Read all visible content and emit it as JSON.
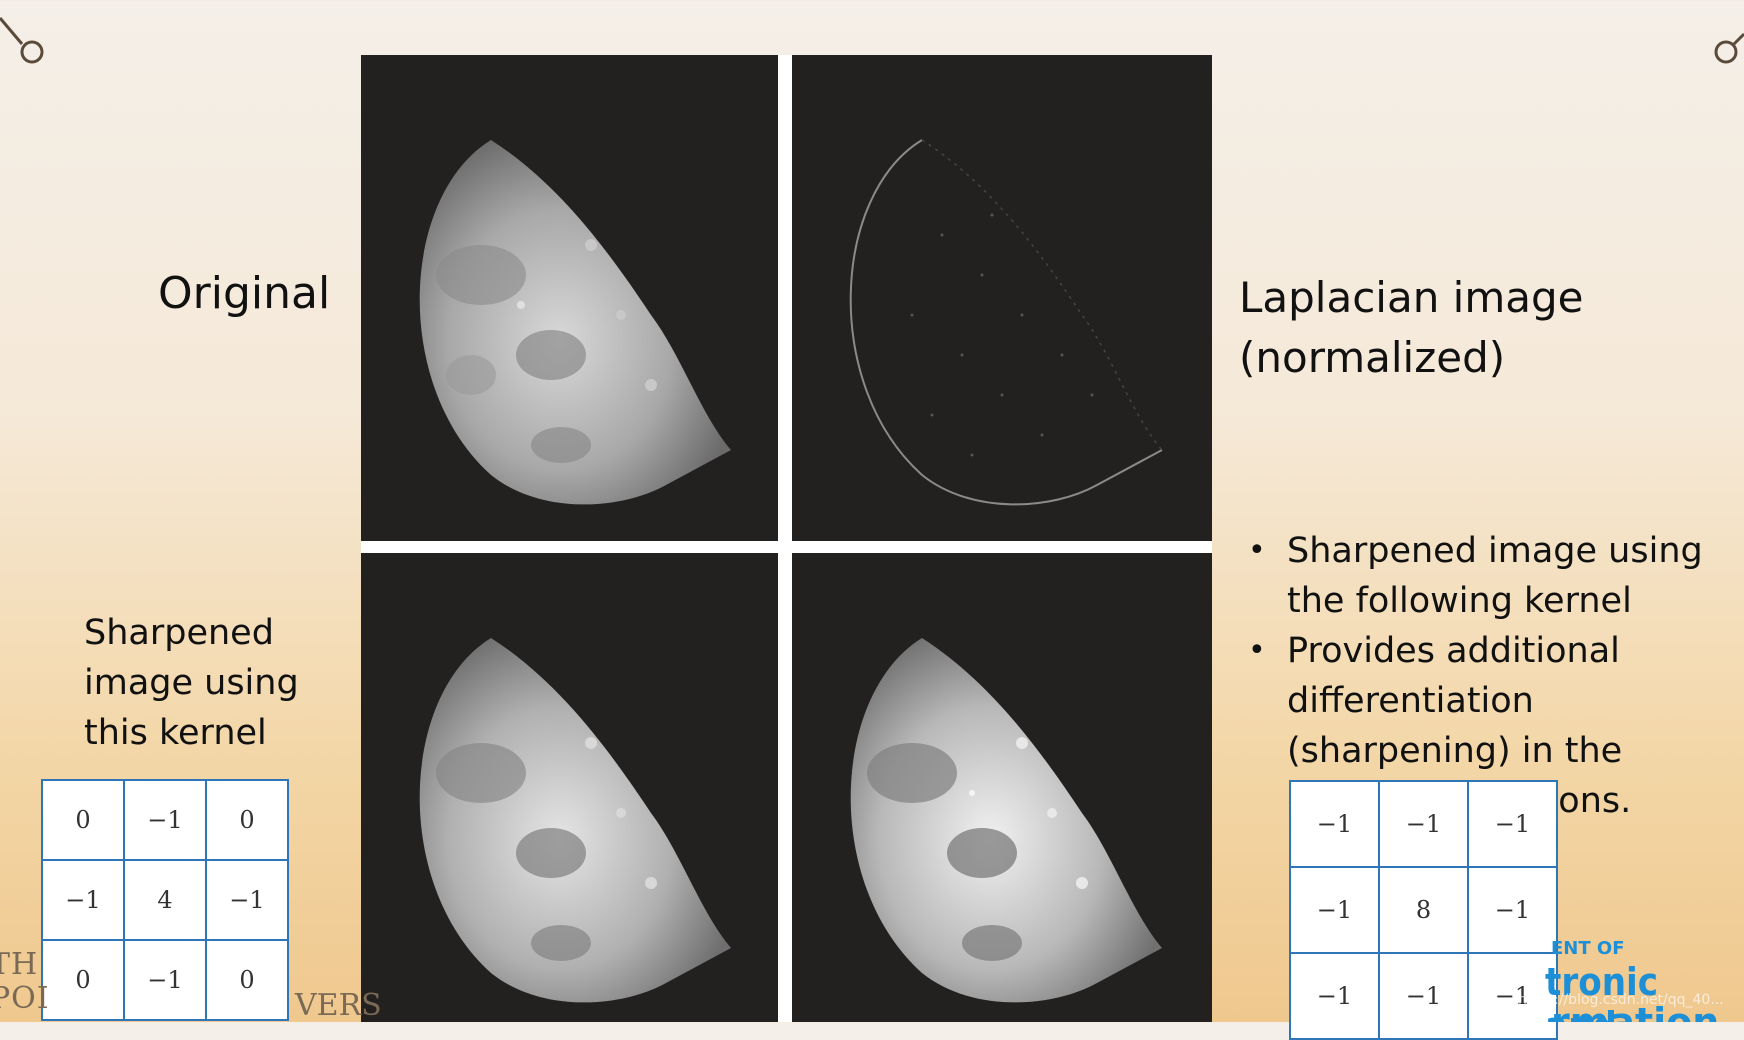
{
  "labels": {
    "original": "Original",
    "laplacian_line1": "Laplacian image",
    "laplacian_line2": "(normalized)",
    "sharpened_line1": "Sharpened",
    "sharpened_line2": "image using",
    "sharpened_line3": "this kernel"
  },
  "bullets": [
    "Sharpened image using the following kernel",
    "Provides additional differentiation (sharpening) in the diagonal directions."
  ],
  "kernels": {
    "left": [
      [
        "0",
        "−1",
        "0"
      ],
      [
        "−1",
        "4",
        "−1"
      ],
      [
        "0",
        "−1",
        "0"
      ]
    ],
    "right": [
      [
        "−1",
        "−1",
        "−1"
      ],
      [
        "−1",
        "8",
        "−1"
      ],
      [
        "−1",
        "−1",
        "−1"
      ]
    ]
  },
  "footer": {
    "line1": "TH",
    "line2": "POI",
    "line3": "VERS",
    "logo_line1": "ENT OF",
    "logo_line2": "tronic and",
    "logo_line3": "rmation"
  },
  "watermark": "https://blog.csdn.net/qq_40..."
}
